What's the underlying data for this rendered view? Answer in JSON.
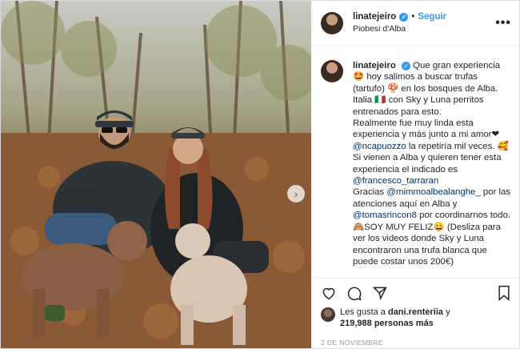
{
  "post": {
    "username": "linatejeiro",
    "follow_label": "Seguir",
    "separator": "•",
    "location": "Piobesi d'Alba",
    "more_label": "•••",
    "next_label": "›",
    "caption_parts": [
      "Que gran experiencia 🤩 hoy salimos a buscar trufas (tartufo) 🍄 en los bosques de Alba. Italia 🇮🇹 con Sky y Luna perritos entrenados para esto.",
      "Realmente fue muy linda esta experiencia y más junto a mi amor❤",
      "@ncapuozzo",
      " la repetiría mil veces. 🥰",
      "Si vienen a Alba y quieren tener esta experiencia el indicado es",
      "@francesco_tarraran",
      "Gracias ",
      "@mimmoalbealanghe_",
      " por las atenciones aquí en Alba y",
      "@tomasrincon8",
      " por coordinarnos todo. 🙈SOY MUY FELIZ😀 (Desliza para ver los videos donde Sky y Luna encontraron una trufa blanca que puede costar unos 200€)"
    ],
    "likes_prefix": "Les gusta a ",
    "likes_user": "dani.renteriia",
    "likes_mid": " y",
    "likes_count": "219,988 personas más",
    "date": "2 DE NOVIEMBRE"
  },
  "icons": {
    "like": "heart-icon",
    "comment": "comment-icon",
    "share": "share-icon",
    "save": "bookmark-icon",
    "verified": "verified-badge-icon"
  },
  "colors": {
    "accent": "#3897f0",
    "mention": "#003569"
  }
}
